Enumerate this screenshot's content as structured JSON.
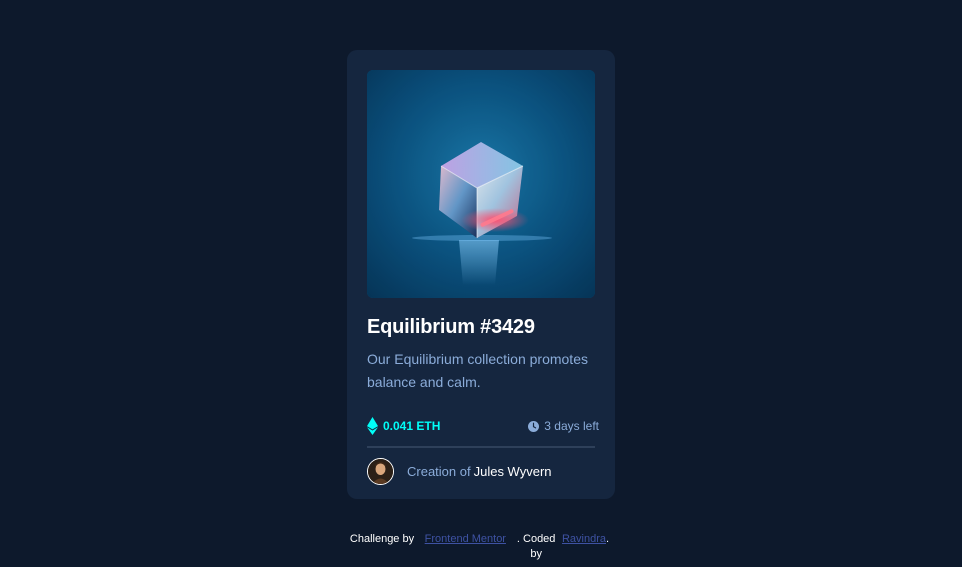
{
  "card": {
    "title": "Equilibrium #3429",
    "description": "Our Equilibrium collection promotes balance and calm.",
    "price": "0.041 ETH",
    "time_left": "3 days left",
    "creator_prefix": "Creation of",
    "creator_name": "Jules Wyvern"
  },
  "attribution": {
    "challenge_by": "Challenge by",
    "frontend_mentor": "Frontend Mentor",
    "coded_by": ". Coded by",
    "author": "Ravindra",
    "period": "."
  },
  "colors": {
    "background": "#0d192c",
    "card": "#15263f",
    "accent": "#00fff8",
    "soft_blue": "#8bacd9",
    "line": "#2e405a"
  },
  "icons": {
    "price": "ethereum-icon",
    "time": "clock-icon"
  }
}
